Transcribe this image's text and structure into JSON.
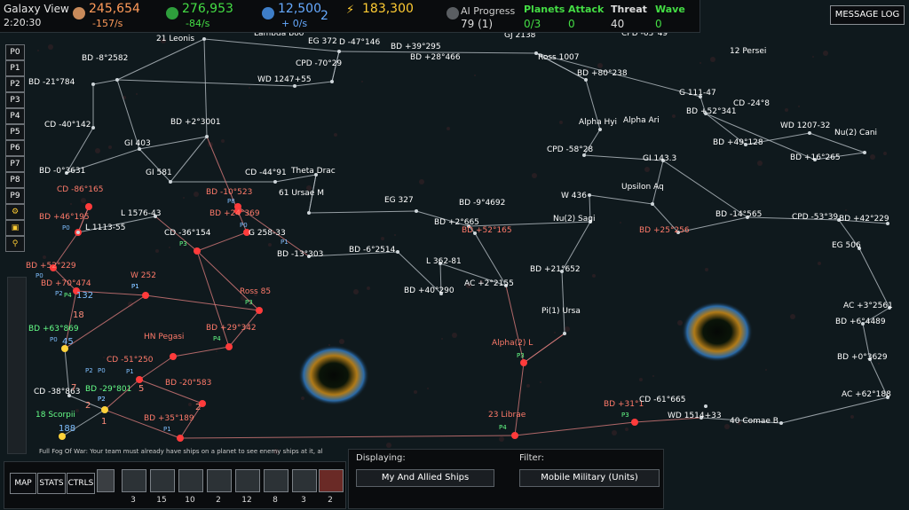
{
  "header": {
    "title": "Galaxy View",
    "clock": "2:20:30",
    "metal": {
      "value": "245,654",
      "rate": "-157/s",
      "icon": "metal-icon"
    },
    "crystal": {
      "value": "276,953",
      "rate": "-84/s",
      "icon": "crystal-icon"
    },
    "energy": {
      "value": "12,500",
      "rate": "+ 0/s",
      "extra": "2",
      "icon": "energy-icon"
    },
    "science": {
      "value": "183,300",
      "icon": "science-icon"
    },
    "ai_progress": {
      "label": "AI Progress",
      "value": "79 (1)",
      "icon": "ai-icon"
    },
    "planets": {
      "label": "Planets",
      "value": "0/3"
    },
    "attack": {
      "label": "Attack",
      "value": "0"
    },
    "threat": {
      "label": "Threat",
      "value": "40"
    },
    "wave": {
      "label": "Wave",
      "value": "0"
    },
    "message_log": "MESSAGE LOG"
  },
  "sidebar": {
    "players": [
      "P0",
      "P1",
      "P2",
      "P3",
      "P4",
      "P5",
      "P6",
      "P7",
      "P8",
      "P9"
    ]
  },
  "bottom": {
    "buttons": {
      "map": "MAP",
      "stats": "STATS",
      "ctrls": "CTRLS"
    },
    "unit_counts": [
      "3",
      "15",
      "10",
      "2",
      "12",
      "8",
      "3",
      "2"
    ],
    "displaying_label": "Displaying:",
    "displaying_value": "My And Allied Ships",
    "filter_label": "Filter:",
    "filter_value": "Mobile Military (Units)",
    "fog_text": "Full Fog Of War: Your team must already have ships on a planet to see enemy ships at it, al"
  },
  "colors": {
    "star_label": "#ffffff",
    "hostile_label": "#ff7a6a",
    "player_label": "#7fbfff",
    "ally_label": "#66ff88",
    "line": "#b8c0c6",
    "metal": "#ff9b5a",
    "crystal": "#44dd44",
    "energy": "#66aaff",
    "science": "#ffcc33"
  },
  "stars": [
    {
      "name": "21 Leonis",
      "c": "w"
    },
    {
      "name": "Lambda Boo",
      "c": "w"
    },
    {
      "name": "EG 372",
      "c": "w"
    },
    {
      "name": "D -47°146",
      "c": "w"
    },
    {
      "name": "BD +39°295",
      "c": "w"
    },
    {
      "name": "GJ 2138",
      "c": "w"
    },
    {
      "name": "CPD -63°49",
      "c": "w"
    },
    {
      "name": "BD -8°2582",
      "c": "w"
    },
    {
      "name": "CPD -70°29",
      "c": "w"
    },
    {
      "name": "BD +28°466",
      "c": "w"
    },
    {
      "name": "Ross 1007",
      "c": "w"
    },
    {
      "name": "12 Persei",
      "c": "w"
    },
    {
      "name": "BD -21°784",
      "c": "w"
    },
    {
      "name": "WD 1247+55",
      "c": "w"
    },
    {
      "name": "BD +80°238",
      "c": "w"
    },
    {
      "name": "G 111-47",
      "c": "w"
    },
    {
      "name": "CD -24°8",
      "c": "w"
    },
    {
      "name": "BD +52°341",
      "c": "w"
    },
    {
      "name": "Alpha Hyi",
      "c": "w"
    },
    {
      "name": "Alpha Ari",
      "c": "w"
    },
    {
      "name": "WD 1207-32",
      "c": "w"
    },
    {
      "name": "Nu(2) Cani",
      "c": "w"
    },
    {
      "name": "CD -40°142",
      "c": "w"
    },
    {
      "name": "BD +2°3001",
      "c": "w"
    },
    {
      "name": "GI 403",
      "c": "w"
    },
    {
      "name": "BD +49°128",
      "c": "w"
    },
    {
      "name": "BD +16°265",
      "c": "w"
    },
    {
      "name": "CPD -58°28",
      "c": "w"
    },
    {
      "name": "GI 143.3",
      "c": "w"
    },
    {
      "name": "BD -0°3631",
      "c": "w"
    },
    {
      "name": "GI 581",
      "c": "w"
    },
    {
      "name": "CD -44°91",
      "c": "w"
    },
    {
      "name": "Theta Drac",
      "c": "w"
    },
    {
      "name": "Upsilon Aq",
      "c": "w"
    },
    {
      "name": "CD -86°165",
      "c": "h"
    },
    {
      "name": "BD -10°523",
      "c": "h"
    },
    {
      "name": "61 Ursae M",
      "c": "w"
    },
    {
      "name": "W 436",
      "c": "w"
    },
    {
      "name": "EG 327",
      "c": "w"
    },
    {
      "name": "BD -9°4692",
      "c": "w"
    },
    {
      "name": "L 1576-43",
      "c": "w"
    },
    {
      "name": "BD +24°369",
      "c": "h"
    },
    {
      "name": "BD +46°195",
      "c": "h"
    },
    {
      "name": "BD -14°565",
      "c": "w"
    },
    {
      "name": "CPD -53°39",
      "c": "w"
    },
    {
      "name": "BD +42°229",
      "c": "w"
    },
    {
      "name": "L 1113-55",
      "c": "w"
    },
    {
      "name": "BD +2°665",
      "c": "w"
    },
    {
      "name": "Nu(2) Sagi",
      "c": "w"
    },
    {
      "name": "BD +52°165",
      "c": "h"
    },
    {
      "name": "BD +25°256",
      "c": "h"
    },
    {
      "name": "CD -36°154",
      "c": "w"
    },
    {
      "name": "G 258-33",
      "c": "w"
    },
    {
      "name": "EG 506",
      "c": "w"
    },
    {
      "name": "BD -6°2514",
      "c": "w"
    },
    {
      "name": "BD -13°303",
      "c": "w"
    },
    {
      "name": "BD +52°229",
      "c": "h"
    },
    {
      "name": "L 362-81",
      "c": "w"
    },
    {
      "name": "BD +21°652",
      "c": "w"
    },
    {
      "name": "W 252",
      "c": "h"
    },
    {
      "name": "BD +70°474",
      "c": "h"
    },
    {
      "name": "AC +2°2155",
      "c": "w"
    },
    {
      "name": "BD +40°290",
      "c": "w"
    },
    {
      "name": "Ross 85",
      "c": "h"
    },
    {
      "name": "AC +3°2561",
      "c": "w"
    },
    {
      "name": "Pi(1) Ursa",
      "c": "w"
    },
    {
      "name": "BD +63°869",
      "c": "a"
    },
    {
      "name": "BD +29°342",
      "c": "h"
    },
    {
      "name": "BD +6°4489",
      "c": "w"
    },
    {
      "name": "HN Pegasi",
      "c": "h"
    },
    {
      "name": "Alpha(2) L",
      "c": "h"
    },
    {
      "name": "CD -51°250",
      "c": "h"
    },
    {
      "name": "BD +0°3629",
      "c": "w"
    },
    {
      "name": "CD -38°863",
      "c": "w"
    },
    {
      "name": "BD -29°801",
      "c": "a"
    },
    {
      "name": "BD -20°583",
      "c": "h"
    },
    {
      "name": "AC +62°188",
      "c": "w"
    },
    {
      "name": "BD +31°1",
      "c": "h"
    },
    {
      "name": "CD -61°665",
      "c": "w"
    },
    {
      "name": "18 Scorpii",
      "c": "a"
    },
    {
      "name": "23 Librae",
      "c": "h"
    },
    {
      "name": "WD 1514+33",
      "c": "w"
    },
    {
      "name": "BD +35°189",
      "c": "h"
    },
    {
      "name": "40 Comae B",
      "c": "w"
    }
  ],
  "player_tags": [
    "P0",
    "P0",
    "P8",
    "P3",
    "P1",
    "P0",
    "P1",
    "P2",
    "P4",
    "P0",
    "P2",
    "P3",
    "P3",
    "P4",
    "P2",
    "P0",
    "P2",
    "P1",
    "P3",
    "P4",
    "P1",
    "P1"
  ],
  "ship_counts": [
    "132",
    "45",
    "18",
    "188",
    "7",
    "5",
    "1",
    "2",
    "2"
  ]
}
